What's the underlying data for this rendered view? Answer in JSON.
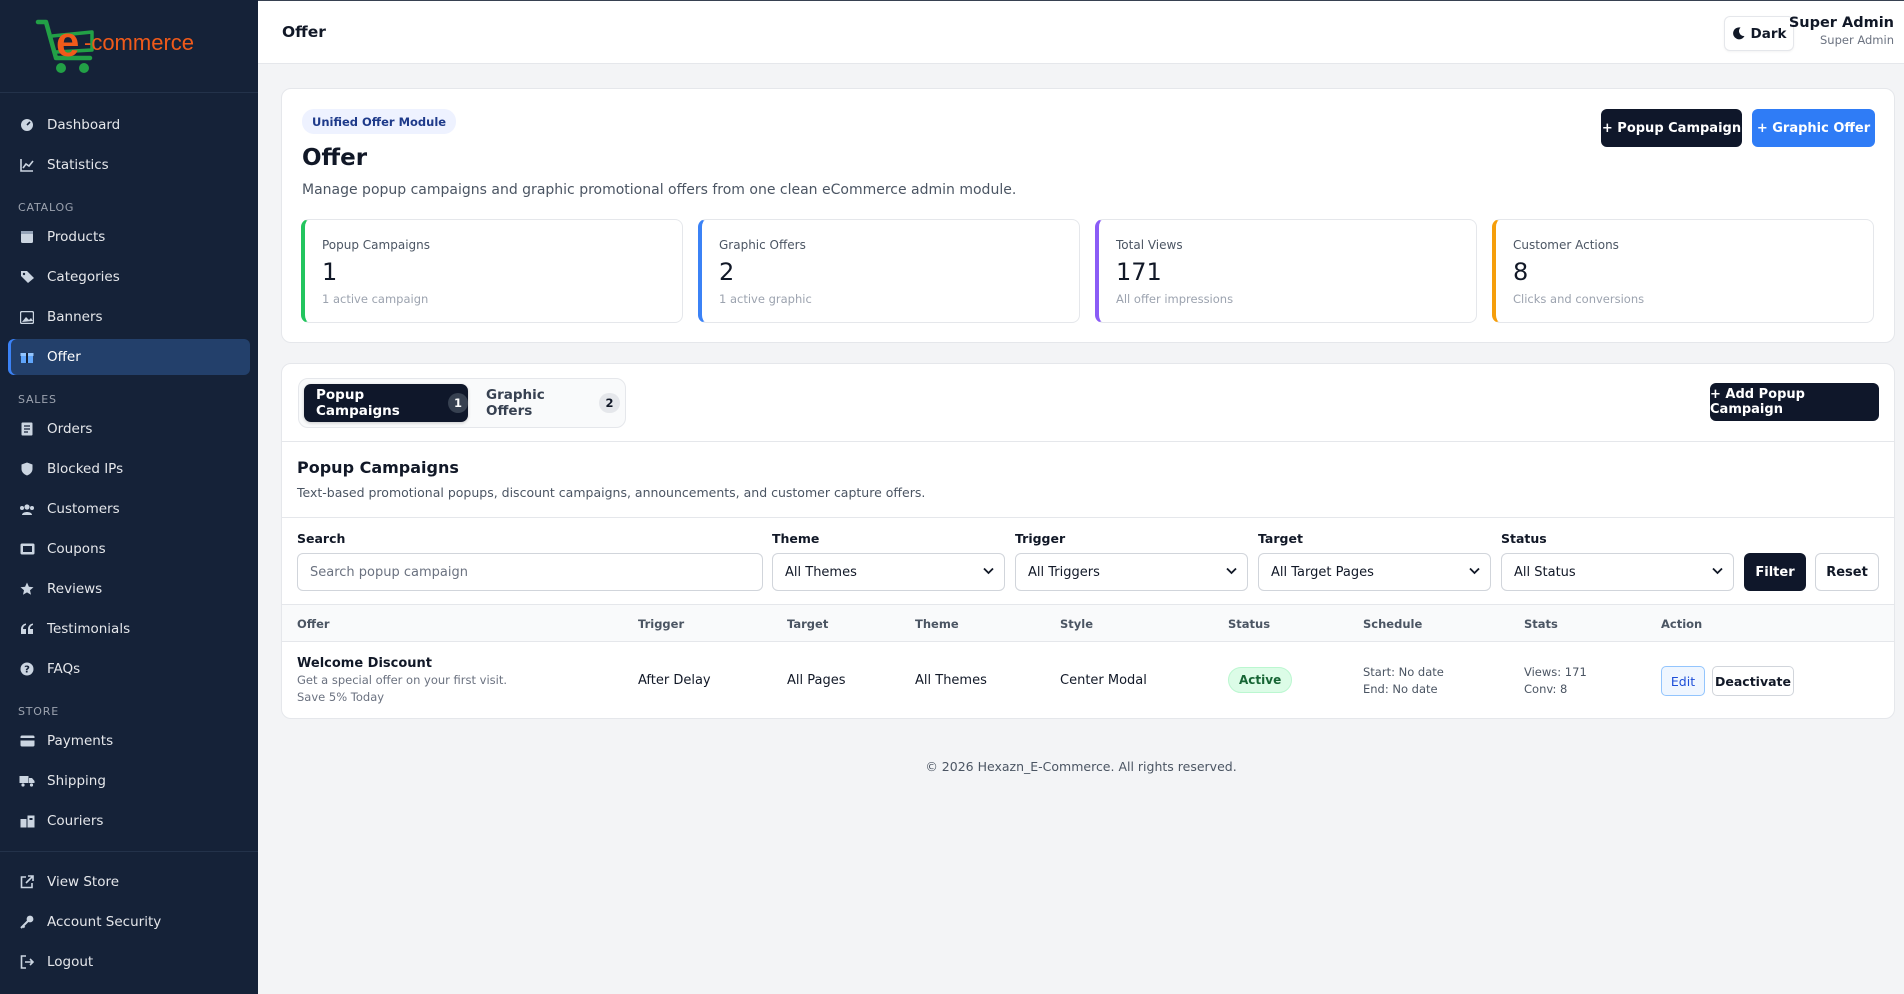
{
  "brand": {
    "logo_text": "e-commerce",
    "logo_e": "e",
    "logo_rest": "-commerce",
    "accent": "#f05a1a",
    "cart_color": "#22a046"
  },
  "sidebar": {
    "top_items": [
      {
        "label": "Dashboard",
        "icon": "dashboard-icon"
      },
      {
        "label": "Statistics",
        "icon": "chart-icon"
      }
    ],
    "sections": [
      {
        "title": "CATALOG",
        "items": [
          {
            "label": "Products",
            "icon": "box-icon"
          },
          {
            "label": "Categories",
            "icon": "tags-icon"
          },
          {
            "label": "Banners",
            "icon": "image-icon"
          },
          {
            "label": "Offer",
            "icon": "gift-icon",
            "active": true
          }
        ]
      },
      {
        "title": "SALES",
        "items": [
          {
            "label": "Orders",
            "icon": "receipt-icon"
          },
          {
            "label": "Blocked IPs",
            "icon": "shield-icon"
          },
          {
            "label": "Customers",
            "icon": "users-icon"
          },
          {
            "label": "Coupons",
            "icon": "ticket-icon"
          },
          {
            "label": "Reviews",
            "icon": "star-icon"
          },
          {
            "label": "Testimonials",
            "icon": "quote-icon"
          },
          {
            "label": "FAQs",
            "icon": "question-icon"
          }
        ]
      },
      {
        "title": "STORE",
        "items": [
          {
            "label": "Payments",
            "icon": "card-icon"
          },
          {
            "label": "Shipping",
            "icon": "truck-icon"
          },
          {
            "label": "Couriers",
            "icon": "building-icon"
          }
        ]
      }
    ],
    "bottom_items": [
      {
        "label": "View Store",
        "icon": "external-link-icon"
      },
      {
        "label": "Account Security",
        "icon": "key-icon"
      },
      {
        "label": "Logout",
        "icon": "logout-icon"
      }
    ]
  },
  "topbar": {
    "title": "Offer",
    "theme_toggle": "Dark",
    "user_name": "Super Admin",
    "user_role": "Super Admin"
  },
  "hero": {
    "badge": "Unified Offer Module",
    "title": "Offer",
    "description": "Manage popup campaigns and graphic promotional offers from one clean eCommerce admin module.",
    "btn_popup": "+ Popup Campaign",
    "btn_graphic": "+ Graphic Offer",
    "stats": [
      {
        "label": "Popup Campaigns",
        "value": "1",
        "sub": "1 active campaign",
        "color": "#22c55e"
      },
      {
        "label": "Graphic Offers",
        "value": "2",
        "sub": "1 active graphic",
        "color": "#3b82f6"
      },
      {
        "label": "Total Views",
        "value": "171",
        "sub": "All offer impressions",
        "color": "#8b5cf6"
      },
      {
        "label": "Customer Actions",
        "value": "8",
        "sub": "Clicks and conversions",
        "color": "#f59e0b"
      }
    ]
  },
  "tabs": [
    {
      "label": "Popup Campaigns",
      "count": "1",
      "active": true
    },
    {
      "label": "Graphic Offers",
      "count": "2",
      "active": false
    }
  ],
  "add_button": "+ Add Popup Campaign",
  "section": {
    "title": "Popup Campaigns",
    "subtitle": "Text-based promotional popups, discount campaigns, announcements, and customer capture offers."
  },
  "filters": {
    "search_label": "Search",
    "search_placeholder": "Search popup campaign",
    "theme_label": "Theme",
    "theme_value": "All Themes",
    "trigger_label": "Trigger",
    "trigger_value": "All Triggers",
    "target_label": "Target",
    "target_value": "All Target Pages",
    "status_label": "Status",
    "status_value": "All Status",
    "filter_btn": "Filter",
    "reset_btn": "Reset"
  },
  "table": {
    "headers": [
      "Offer",
      "Trigger",
      "Target",
      "Theme",
      "Style",
      "Status",
      "Schedule",
      "Stats",
      "Action"
    ],
    "rows": [
      {
        "offer_title": "Welcome Discount",
        "offer_desc": "Get a special offer on your first visit.",
        "offer_extra": "Save 5% Today",
        "trigger": "After Delay",
        "target": "All Pages",
        "theme": "All Themes",
        "style": "Center Modal",
        "status": "Active",
        "schedule_start": "Start: No date",
        "schedule_end": "End: No date",
        "stats_views": "Views: 171",
        "stats_conv": "Conv: 8",
        "edit": "Edit",
        "deactivate": "Deactivate"
      }
    ]
  },
  "footer": "© 2026 Hexazn_E-Commerce. All rights reserved."
}
